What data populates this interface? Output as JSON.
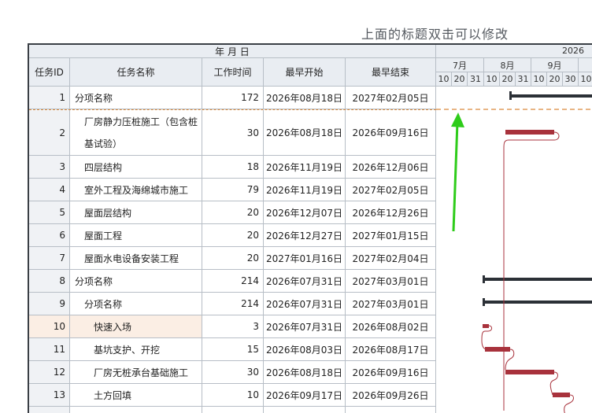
{
  "title_hint": "上面的标题双击可以修改",
  "header": {
    "date_group": "年 月 日",
    "cols": {
      "id": "任务ID",
      "name": "任务名称",
      "duration": "工作时间",
      "start": "最早开始",
      "end": "最早结束"
    }
  },
  "timeline": {
    "year": "2026",
    "months": [
      "7月",
      "8月",
      "9月"
    ],
    "days": [
      "10",
      "20",
      "31",
      "10",
      "20",
      "31",
      "10",
      "20",
      "30",
      "10"
    ]
  },
  "tasks": [
    {
      "id": "1",
      "name": "分项名称",
      "duration": "172",
      "start": "2026年08月18日",
      "end": "2027年02月05日"
    },
    {
      "id": "2",
      "name": "厂房静力压桩施工（包含桩基试验）",
      "duration": "30",
      "start": "2026年08月18日",
      "end": "2026年09月16日"
    },
    {
      "id": "3",
      "name": "四层结构",
      "duration": "18",
      "start": "2026年11月19日",
      "end": "2026年12月06日"
    },
    {
      "id": "4",
      "name": "室外工程及海绵城市施工",
      "duration": "79",
      "start": "2026年11月19日",
      "end": "2027年02月05日"
    },
    {
      "id": "5",
      "name": "屋面层结构",
      "duration": "20",
      "start": "2026年12月07日",
      "end": "2026年12月26日"
    },
    {
      "id": "6",
      "name": "屋面工程",
      "duration": "20",
      "start": "2026年12月27日",
      "end": "2027年01月15日"
    },
    {
      "id": "7",
      "name": "屋面水电设备安装工程",
      "duration": "20",
      "start": "2027年01月16日",
      "end": "2027年02月04日"
    },
    {
      "id": "8",
      "name": "分项名称",
      "duration": "214",
      "start": "2026年07月31日",
      "end": "2027年03月01日"
    },
    {
      "id": "9",
      "name": "分项名称",
      "duration": "214",
      "start": "2026年07月31日",
      "end": "2027年03月01日"
    },
    {
      "id": "10",
      "name": "快速入场",
      "duration": "3",
      "start": "2026年07月31日",
      "end": "2026年08月02日"
    },
    {
      "id": "11",
      "name": "基坑支护、开挖",
      "duration": "15",
      "start": "2026年08月03日",
      "end": "2026年08月17日"
    },
    {
      "id": "12",
      "name": "厂房无桩承台基础施工",
      "duration": "30",
      "start": "2026年08月18日",
      "end": "2026年09月16日"
    },
    {
      "id": "13",
      "name": "土方回填",
      "duration": "10",
      "start": "2026年09月17日",
      "end": "2026年09月26日"
    }
  ],
  "colors": {
    "summary_bar": "#2b3036",
    "task_bar": "#a8323c",
    "link_line": "#a8323c",
    "dashed_line": "#d9893c",
    "arrow": "#2ecc1a",
    "selected_row": "#fbeee4"
  }
}
